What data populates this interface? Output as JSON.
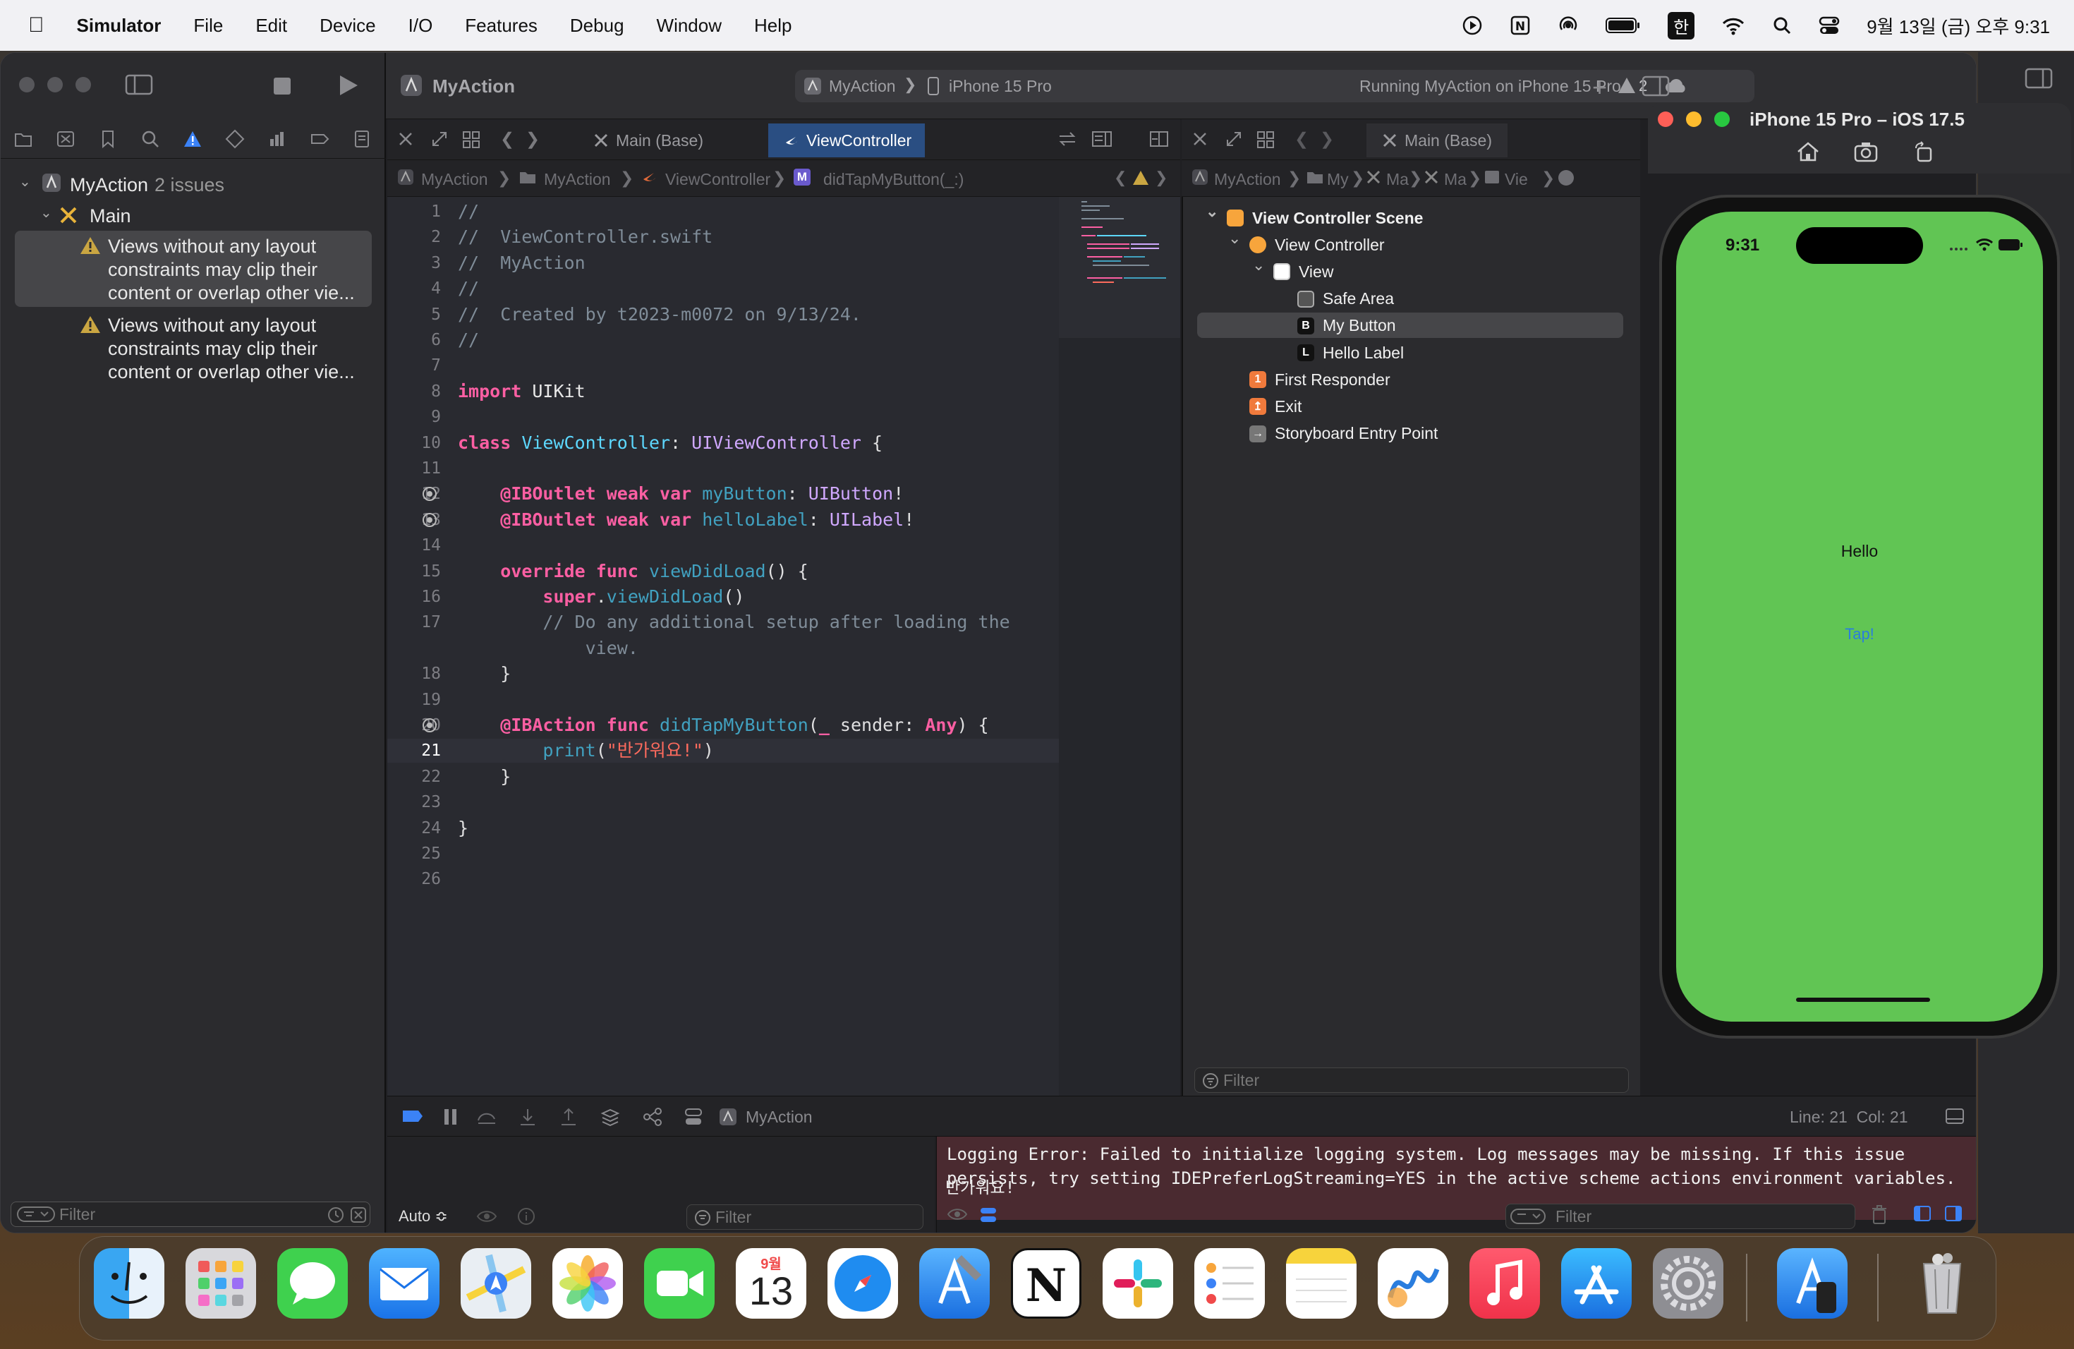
{
  "menubar": {
    "app": "Simulator",
    "items": [
      "File",
      "Edit",
      "Device",
      "I/O",
      "Features",
      "Debug",
      "Window",
      "Help"
    ],
    "ime": "한",
    "clock": "9월 13일 (금) 오후 9:31"
  },
  "xcode": {
    "project": "MyAction",
    "scheme_target": "MyAction",
    "device": "iPhone 15 Pro",
    "status": "Running MyAction on iPhone 15 Pro",
    "warnings_count": "2",
    "navigator": {
      "project_label": "MyAction",
      "issues_label": "2 issues",
      "group": "Main",
      "issues": [
        "Views without any layout constraints may clip their content or overlap other vie...",
        "Views without any layout constraints may clip their content or overlap other vie..."
      ],
      "filter_placeholder": "Filter"
    },
    "editor": {
      "tab_inactive": "Main (Base)",
      "tab_active": "ViewController",
      "breadcrumb": [
        "MyAction",
        "MyAction",
        "ViewController",
        "didTapMyButton(_:)"
      ],
      "lines": [
        {
          "n": "1",
          "html": "<span class='cm'>//</span>"
        },
        {
          "n": "2",
          "html": "<span class='cm'>//  ViewController.swift</span>"
        },
        {
          "n": "3",
          "html": "<span class='cm'>//  MyAction</span>"
        },
        {
          "n": "4",
          "html": "<span class='cm'>//</span>"
        },
        {
          "n": "5",
          "html": "<span class='cm'>//  Created by t2023-m0072 on 9/13/24.</span>"
        },
        {
          "n": "6",
          "html": "<span class='cm'>//</span>"
        },
        {
          "n": "7",
          "html": ""
        },
        {
          "n": "8",
          "html": "<span class='kw'>import</span> <span class='tx'>UIKit</span>"
        },
        {
          "n": "9",
          "html": ""
        },
        {
          "n": "10",
          "html": "<span class='kw'>class</span> <span class='cls'>ViewController</span>: <span class='ty'>UIViewController</span> {"
        },
        {
          "n": "11",
          "html": ""
        },
        {
          "n": "12",
          "html": "    <span class='kw'>@IBOutlet</span> <span class='kw'>weak</span> <span class='kw'>var</span> <span class='pr'>myButton</span>: <span class='ty'>UIButton</span>!"
        },
        {
          "n": "13",
          "html": "    <span class='kw'>@IBOutlet</span> <span class='kw'>weak</span> <span class='kw'>var</span> <span class='pr'>helloLabel</span>: <span class='ty'>UILabel</span>!"
        },
        {
          "n": "14",
          "html": ""
        },
        {
          "n": "15",
          "html": "    <span class='kw'>override</span> <span class='kw'>func</span> <span class='pr'>viewDidLoad</span>() {"
        },
        {
          "n": "16",
          "html": "        <span class='kw'>super</span>.<span class='pr'>viewDidLoad</span>()"
        },
        {
          "n": "17",
          "html": "        <span class='cm'>// Do any additional setup after loading the</span>"
        },
        {
          "n": "",
          "html": "            <span class='cm'>view.</span>"
        },
        {
          "n": "18",
          "html": "    }"
        },
        {
          "n": "19",
          "html": ""
        },
        {
          "n": "20",
          "html": "    <span class='kw'>@IBAction</span> <span class='kw'>func</span> <span class='pr'>didTapMyButton</span>(<span class='kw'>_</span> sender: <span class='kw'>Any</span>) {"
        },
        {
          "n": "21",
          "html": "        <span class='pr'>print</span>(<span class='st'>\"반가워요!\"</span>)"
        },
        {
          "n": "22",
          "html": "    }"
        },
        {
          "n": "23",
          "html": ""
        },
        {
          "n": "24",
          "html": "}"
        },
        {
          "n": "25",
          "html": ""
        },
        {
          "n": "26",
          "html": ""
        }
      ]
    },
    "storyboard": {
      "tab": "Main (Base)",
      "breadcrumb": [
        "MyAction",
        "My",
        "Ma",
        "Ma",
        "Vie"
      ],
      "outline": [
        {
          "label": "View Controller Scene",
          "level": 0
        },
        {
          "label": "View Controller",
          "level": 1
        },
        {
          "label": "View",
          "level": 2
        },
        {
          "label": "Safe Area",
          "level": 3
        },
        {
          "label": "My Button",
          "level": 3
        },
        {
          "label": "Hello Label",
          "level": 3
        },
        {
          "label": "First Responder",
          "level": 1
        },
        {
          "label": "Exit",
          "level": 1
        },
        {
          "label": "Storyboard Entry Point",
          "level": 1
        }
      ],
      "filter_placeholder": "Filter"
    },
    "debug": {
      "target": "MyAction",
      "position": "Line: 21  Col: 21",
      "auto": "Auto ≎",
      "vars_filter": "Filter",
      "console_filter": "Filter",
      "error": "Logging Error: Failed to initialize logging system. Log messages may be missing. If this issue persists, try setting IDEPreferLogStreaming=YES in the active scheme actions environment variables.",
      "output": "반가워요!"
    }
  },
  "simulator": {
    "title": "iPhone 15 Pro – iOS 17.5",
    "time": "9:31",
    "hello": "Hello",
    "tap": "Tap!",
    "screen_color": "#61c554"
  },
  "dock": {
    "calendar_month": "9월",
    "calendar_day": "13"
  },
  "colors": {
    "accent": "#2a4e82",
    "keyword": "#fc5fa3"
  }
}
